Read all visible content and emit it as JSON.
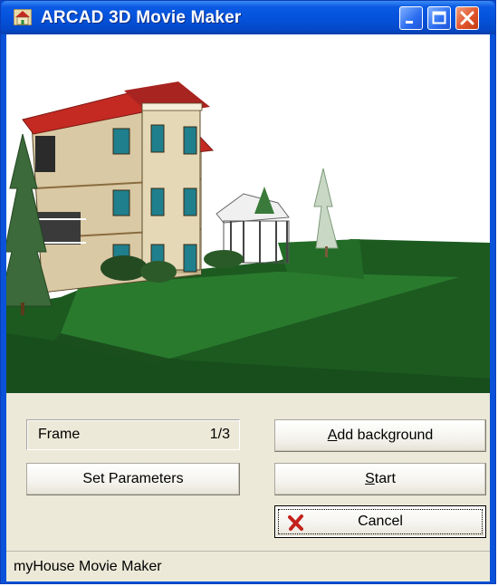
{
  "window": {
    "title": "ARCAD 3D Movie Maker",
    "app_icon": "house-icon",
    "controls": [
      "minimize-icon",
      "maximize-icon",
      "close-icon"
    ]
  },
  "frame": {
    "label": "Frame",
    "value": "1/3"
  },
  "buttons": {
    "set_parameters": "Set Parameters",
    "add_background": {
      "mnemonic": "A",
      "rest": "dd background"
    },
    "start": {
      "mnemonic": "S",
      "rest": "tart"
    },
    "cancel": "Cancel"
  },
  "status": "myHouse Movie Maker",
  "colors": {
    "titlebar": "#0a52d9",
    "face": "#ece9d8",
    "lawn": "#1f6b24",
    "roof": "#c42a22",
    "cancel_x": "#c2221b"
  }
}
